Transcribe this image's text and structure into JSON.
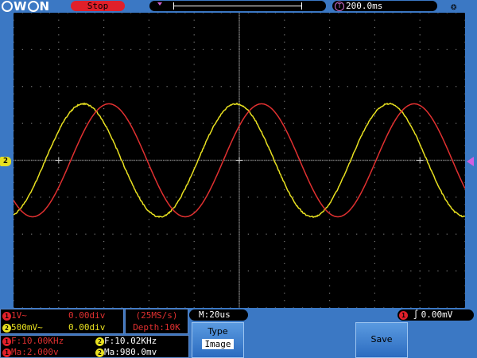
{
  "header": {
    "logo": [
      "O",
      "W",
      "O",
      "N"
    ],
    "status": "Stop",
    "timebase_icon": "T",
    "timebase": "200.0ms",
    "usb_icon": "usb-icon"
  },
  "ch2_marker": "2",
  "channels": [
    {
      "num": "1",
      "scale": "1V~",
      "offset": "0.00div",
      "color": "#e03030"
    },
    {
      "num": "2",
      "scale": "500mV~",
      "offset": "0.00div",
      "color": "#e8e020"
    }
  ],
  "acquisition": {
    "rate": "(25MS/s)",
    "depth": "Depth:10K"
  },
  "measurements": {
    "ch1_freq": "F:10.00KHz",
    "ch2_freq": "F:10.02KHz",
    "ch1_ma": "Ma:2.000v",
    "ch2_ma": "Ma:980.0mv"
  },
  "memory": "M:20us",
  "trigger": {
    "channel": "1",
    "edge_icon": "rising-edge-icon",
    "level": "0.00mV"
  },
  "softkeys": {
    "type_label": "Type",
    "type_value": "Image",
    "save_label": "Save"
  },
  "colors": {
    "ch1": "#e03030",
    "ch2": "#e8e020",
    "grid": "#7a7a7a",
    "background": "#000000",
    "frame": "#3b78c4"
  }
}
